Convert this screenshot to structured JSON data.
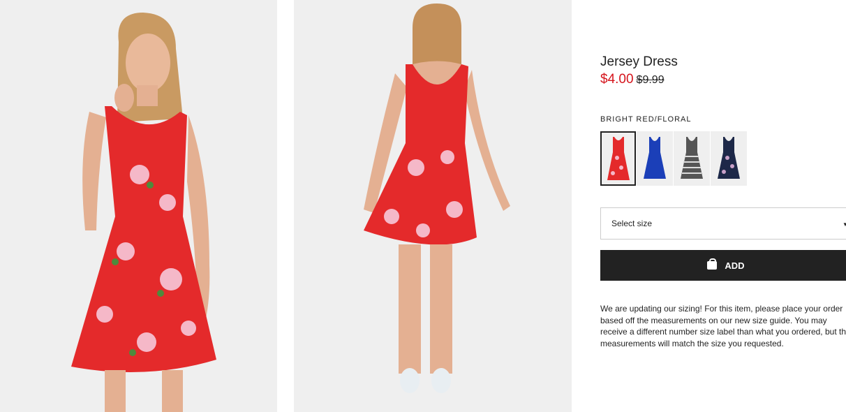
{
  "product": {
    "title": "Jersey Dress",
    "sale_price": "$4.00",
    "original_price": "$9.99",
    "color_label": "BRIGHT RED/FLORAL"
  },
  "swatches": [
    {
      "name": "red-floral",
      "color": "#e2262a",
      "selected": true
    },
    {
      "name": "blue",
      "color": "#1b3fb8",
      "selected": false
    },
    {
      "name": "black-white-stripe",
      "color": "#555555",
      "selected": false
    },
    {
      "name": "navy-floral",
      "color": "#1d2848",
      "selected": false
    }
  ],
  "size_select": {
    "label": "Select size",
    "chevron": "▼"
  },
  "add_button": {
    "label": "ADD",
    "icon": "bag-icon"
  },
  "notice": "We are updating our sizing! For this item, please place your order based off the measurements on our new size guide. You may receive a different number size label than what you ordered, but the measurements will match the size you requested.",
  "colors": {
    "sale": "#d5141c",
    "button": "#222222",
    "photo_bg": "#efefef",
    "dress": "#e42a2b"
  }
}
